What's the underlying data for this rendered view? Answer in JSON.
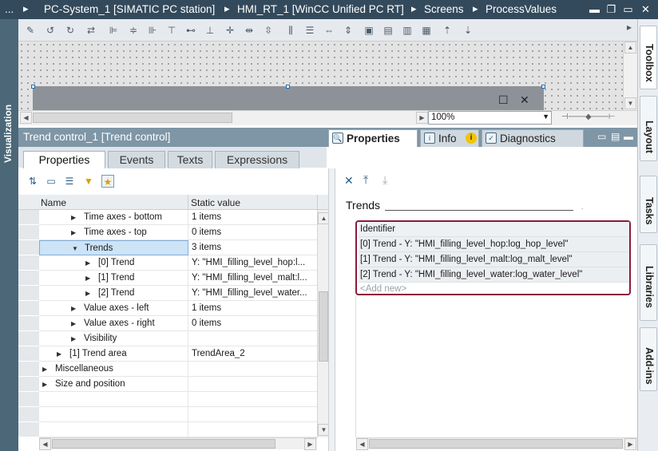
{
  "titlebar": {
    "prefix": "...",
    "crumbs": [
      "PC-System_1 [SIMATIC PC station]",
      "HMI_RT_1 [WinCC Unified PC RT]",
      "Screens",
      "ProcessValues"
    ]
  },
  "leftbar": {
    "label": "Visualization"
  },
  "taskcards": [
    "Toolbox",
    "Layout",
    "Tasks",
    "Libraries",
    "Add-ins"
  ],
  "editor": {
    "zoom": "100%"
  },
  "inspector": {
    "object_title": "Trend control_1 [Trend control]",
    "tabs": [
      "Properties",
      "Info",
      "Diagnostics"
    ],
    "subtabs": [
      "Properties",
      "Events",
      "Texts",
      "Expressions"
    ]
  },
  "property_grid": {
    "columns": [
      "Name",
      "Static value"
    ],
    "rows": [
      {
        "name": "Time axes - bottom",
        "value": "1 items",
        "expander": "collapsed",
        "indent": 2
      },
      {
        "name": "Time axes - top",
        "value": "0 items",
        "expander": "collapsed",
        "indent": 2
      },
      {
        "name": "Trends",
        "value": "3 items",
        "expander": "expanded",
        "indent": 2,
        "selected": true
      },
      {
        "name": "[0] Trend",
        "value": "Y: \"HMI_filling_level_hop:l...",
        "expander": "collapsed",
        "indent": 3
      },
      {
        "name": "[1] Trend",
        "value": "Y: \"HMI_filling_level_malt:l...",
        "expander": "collapsed",
        "indent": 3
      },
      {
        "name": "[2] Trend",
        "value": "Y: \"HMI_filling_level_water...",
        "expander": "collapsed",
        "indent": 3
      },
      {
        "name": "Value axes - left",
        "value": "1 items",
        "expander": "collapsed",
        "indent": 2
      },
      {
        "name": "Value axes - right",
        "value": "0 items",
        "expander": "collapsed",
        "indent": 2
      },
      {
        "name": "Visibility",
        "value": "",
        "expander": "collapsed",
        "indent": 2
      },
      {
        "name": "[1] Trend area",
        "value": "TrendArea_2",
        "expander": "collapsed",
        "indent": 1
      },
      {
        "name": "Miscellaneous",
        "value": "",
        "expander": "collapsed",
        "indent": 0
      },
      {
        "name": "Size and position",
        "value": "",
        "expander": "collapsed",
        "indent": 0
      },
      {
        "name": "",
        "value": "",
        "expander": "none",
        "indent": 0
      },
      {
        "name": "",
        "value": "",
        "expander": "none",
        "indent": 0
      },
      {
        "name": "",
        "value": "",
        "expander": "none",
        "indent": 0
      }
    ]
  },
  "trends_panel": {
    "label": "Trends",
    "header": "Identifier",
    "items": [
      "[0] Trend - Y: \"HMI_filling_level_hop:log_hop_level\"",
      "[1] Trend - Y: \"HMI_filling_level_malt:log_malt_level\"",
      "[2] Trend - Y: \"HMI_filling_level_water:log_water_level\""
    ],
    "add_new": "<Add new>"
  },
  "colors": {
    "titlebar": "#334a5c",
    "leftbar": "#4b6778",
    "highlight_border": "#8b1b3a"
  }
}
